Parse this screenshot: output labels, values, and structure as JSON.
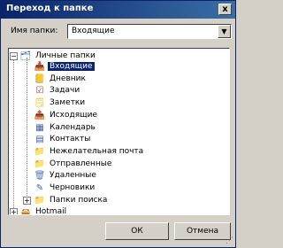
{
  "dialog": {
    "title": "Переход к папке",
    "close_glyph": "x"
  },
  "folder_field": {
    "label": "Имя папки:",
    "value": "Входящие"
  },
  "tree": {
    "root": {
      "label": "Личные папки",
      "expander": "−"
    },
    "items": [
      {
        "label": "Входящие",
        "icon": "inbox-icon",
        "glyph": "📥",
        "color": "#e8b040",
        "selected": true
      },
      {
        "label": "Дневник",
        "icon": "journal-icon",
        "glyph": "📒",
        "color": "#4a7a3a"
      },
      {
        "label": "Задачи",
        "icon": "tasks-icon",
        "glyph": "☑",
        "color": "#c0392b"
      },
      {
        "label": "Заметки",
        "icon": "notes-icon",
        "glyph": "🗒",
        "color": "#e8c840"
      },
      {
        "label": "Исходящие",
        "icon": "outbox-icon",
        "glyph": "📤",
        "color": "#e8b040"
      },
      {
        "label": "Календарь",
        "icon": "calendar-icon",
        "glyph": "▦",
        "color": "#3a5ea8"
      },
      {
        "label": "Контакты",
        "icon": "contacts-icon",
        "glyph": "▤",
        "color": "#3a5ea8"
      },
      {
        "label": "Нежелательная почта",
        "icon": "junk-folder-icon",
        "glyph": "📁",
        "color": "#e8c040"
      },
      {
        "label": "Отправленные",
        "icon": "sent-folder-icon",
        "glyph": "📁",
        "color": "#e8c040"
      },
      {
        "label": "Удаленные",
        "icon": "deleted-items-icon",
        "glyph": "🗑",
        "color": "#5a7ab0"
      },
      {
        "label": "Черновики",
        "icon": "drafts-icon",
        "glyph": "✎",
        "color": "#3a5ea8"
      },
      {
        "label": "Папки поиска",
        "icon": "search-folders-icon",
        "glyph": "📁",
        "color": "#e8c040",
        "expander": "+"
      }
    ],
    "second_root": {
      "label": "Hotmail",
      "icon": "hotmail-icon",
      "expander": "+"
    }
  },
  "buttons": {
    "ok": "ОК",
    "cancel": "Отмена"
  }
}
